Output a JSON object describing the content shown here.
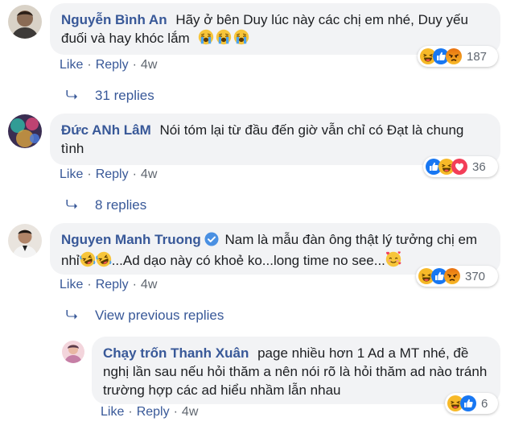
{
  "comments": [
    {
      "author": "Nguyễn Bình An",
      "text": "Hãy ở bên Duy lúc này các chị em nhé, Duy yếu đuối và hay khóc lắm",
      "emojis": [
        "crying-face",
        "crying-face",
        "crying-face"
      ],
      "like": "Like",
      "reply": "Reply",
      "time": "4w",
      "reaction_count": "187",
      "reaction_icons": [
        "haha",
        "like",
        "angry"
      ],
      "replies_label": "31 replies"
    },
    {
      "author": "Đức ANh LâM",
      "text": "Nói tóm lại từ đầu đến giờ vẫn chỉ có Đạt là chung tình",
      "like": "Like",
      "reply": "Reply",
      "time": "4w",
      "reaction_count": "36",
      "reaction_icons": [
        "like",
        "haha",
        "love"
      ],
      "replies_label": "8 replies"
    },
    {
      "author": "Nguyen Manh Truong",
      "verified": true,
      "text_part1": "Nam là mẫu đàn ông thật lý tưởng chị em nhỉ",
      "text_part2": "...Ad dạo này có khoẻ ko...long time no see...",
      "emojis": [
        "rofl",
        "rofl",
        "smiling-face-with-hearts"
      ],
      "like": "Like",
      "reply": "Reply",
      "time": "4w",
      "reaction_count": "370",
      "reaction_icons": [
        "haha",
        "like",
        "angry"
      ],
      "replies_label": "View previous replies"
    }
  ],
  "reply": {
    "author": "Chạy trốn Thanh Xuân",
    "text": "page nhiều hơn 1 Ad a MT nhé, đề nghị lần sau nếu hỏi thăm a nên nói rõ là hỏi thăm ad nào tránh trường hợp các ad hiểu nhầm lẫn nhau",
    "like": "Like",
    "reply": "Reply",
    "time": "4w",
    "reaction_count": "6",
    "reaction_icons": [
      "haha",
      "like"
    ]
  },
  "colors": {
    "link": "#385898",
    "bubble": "#f2f3f5",
    "meta": "#606770",
    "like_blue": "#1877f2",
    "haha_yellow": "#f7b928",
    "love_red": "#f33e58",
    "angry_orange": "#e9710f"
  }
}
